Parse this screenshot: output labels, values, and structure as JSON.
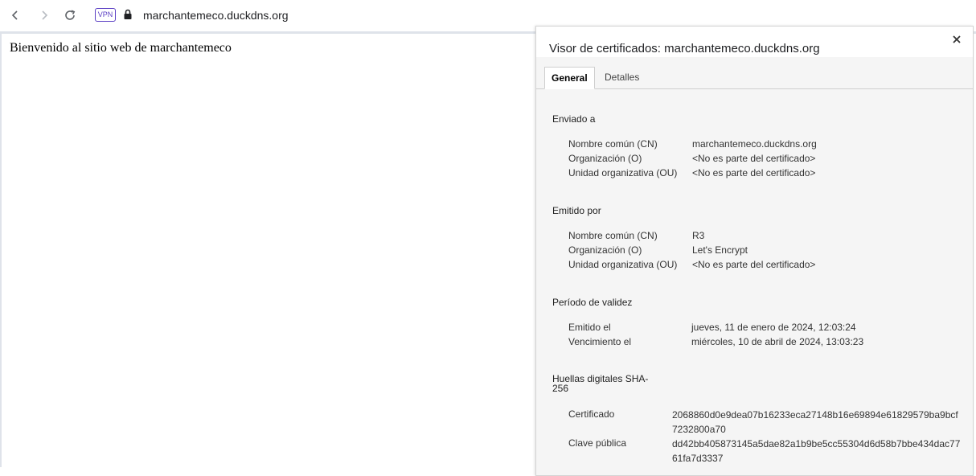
{
  "browser": {
    "vpn_label": "VPN",
    "url_host": "marchantemeco.duckdns.org"
  },
  "page": {
    "welcome_text": "Bienvenido al sitio web de marchantemeco"
  },
  "dialog": {
    "title": "Visor de certificados: marchantemeco.duckdns.org",
    "tabs": [
      {
        "label": "General",
        "active": true
      },
      {
        "label": "Detalles",
        "active": false
      }
    ],
    "issued_to": {
      "heading": "Enviado a",
      "rows": [
        {
          "label": "Nombre común (CN)",
          "value": "marchantemeco.duckdns.org"
        },
        {
          "label": "Organización (O)",
          "value": "<No es parte del certificado>"
        },
        {
          "label": "Unidad organizativa (OU)",
          "value": "<No es parte del certificado>"
        }
      ]
    },
    "issued_by": {
      "heading": "Emitido por",
      "rows": [
        {
          "label": "Nombre común (CN)",
          "value": "R3"
        },
        {
          "label": "Organización (O)",
          "value": "Let's Encrypt"
        },
        {
          "label": "Unidad organizativa (OU)",
          "value": "<No es parte del certificado>"
        }
      ]
    },
    "validity": {
      "heading": "Período de validez",
      "rows": [
        {
          "label": "Emitido el",
          "value": "jueves, 11 de enero de 2024, 12:03:24"
        },
        {
          "label": "Vencimiento el",
          "value": "miércoles, 10 de abril de 2024, 13:03:23"
        }
      ]
    },
    "fingerprints": {
      "heading_line1": "Huellas digitales SHA-",
      "heading_line2": "256",
      "rows": [
        {
          "label": "Certificado",
          "value": "2068860d0e9dea07b16233eca27148b16e69894e61829579ba9bcf7232800a70"
        },
        {
          "label": "Clave pública",
          "value": "dd42bb405873145a5dae82a1b9be5cc55304d6d58b7bbe434dac7761fa7d3337"
        }
      ]
    }
  },
  "colors": {
    "vpn_accent": "#5b3fc4",
    "dialog_background": "#f5f5f5"
  },
  "icons": [
    "back-arrow-icon",
    "forward-arrow-icon",
    "reload-icon",
    "lock-icon",
    "close-icon"
  ]
}
